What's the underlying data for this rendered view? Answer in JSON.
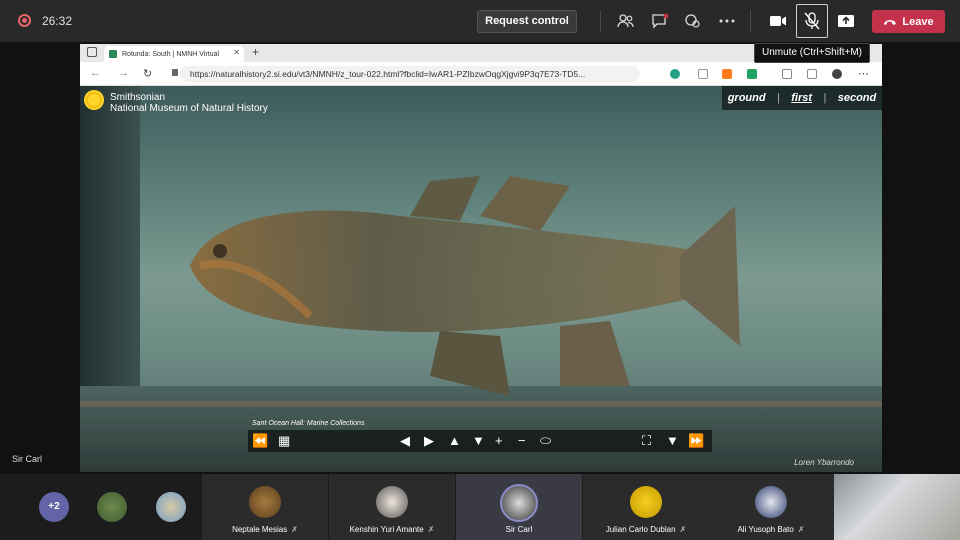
{
  "meeting": {
    "timer": "26:32",
    "request_control_label": "Request control",
    "leave_label": "Leave",
    "tooltip": "Unmute (Ctrl+Shift+M)",
    "presenter_label": "Sir Carl"
  },
  "browser": {
    "tab_title": "Rotunda: South | NMNH Virtual",
    "url": "https://naturalhistory2.si.edu/vt3/NMNH/z_tour-022.html?fbclid=IwAR1-PZIbzwOqgXjgvi9P3q7E73-TD5..."
  },
  "tour": {
    "org": "Smithsonian",
    "museum": "National Museum of Natural History",
    "floors": [
      "ground",
      "first",
      "second"
    ],
    "active_floor": "first",
    "caption": "Sant Ocean Hall: Marine Collections",
    "credit": "Loren Ybarrondo"
  },
  "participants": {
    "overflow_count": "+2",
    "tiles": [
      {
        "name": "Neptale Mesias",
        "muted": true
      },
      {
        "name": "Kenshin Yuri Amante",
        "muted": true
      },
      {
        "name": "Sir Carl",
        "muted": false
      },
      {
        "name": "Julian Carlo Dublan",
        "muted": true
      },
      {
        "name": "Ali Yusoph Bato",
        "muted": true
      }
    ]
  },
  "colors": {
    "leave": "#c4314b",
    "teams_purple": "#6264a7",
    "recording": "#e8646a"
  },
  "icons": {
    "mute_glyph": "🎙"
  }
}
